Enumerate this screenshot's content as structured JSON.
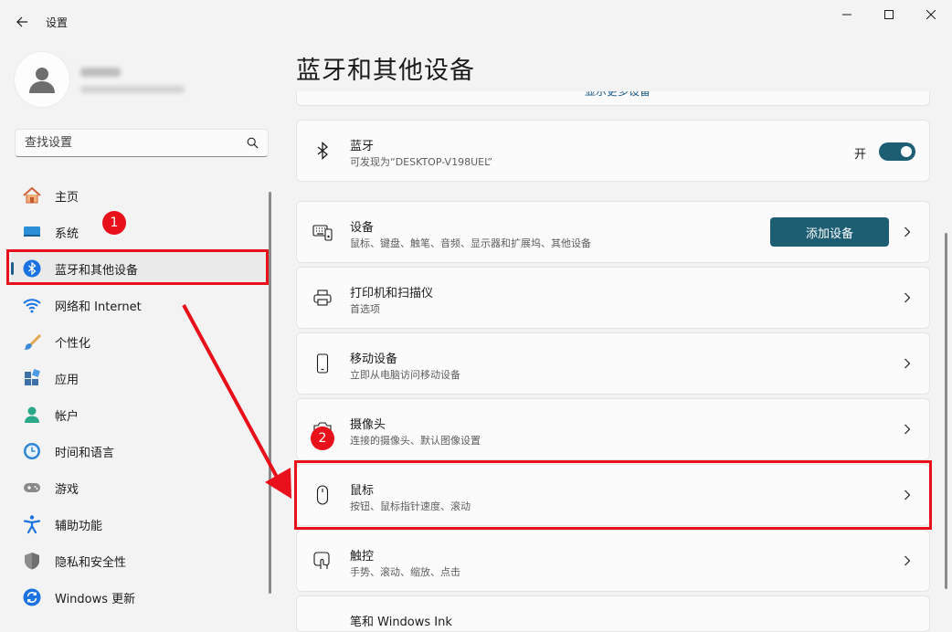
{
  "window": {
    "title": "设置",
    "controls": [
      "minimize",
      "maximize",
      "close"
    ]
  },
  "search": {
    "placeholder": "查找设置"
  },
  "sidebar": {
    "items": [
      {
        "label": "主页",
        "icon": "home-icon"
      },
      {
        "label": "系统",
        "icon": "system-icon"
      },
      {
        "label": "蓝牙和其他设备",
        "icon": "bluetooth-icon",
        "selected": true
      },
      {
        "label": "网络和 Internet",
        "icon": "wifi-icon"
      },
      {
        "label": "个性化",
        "icon": "brush-icon"
      },
      {
        "label": "应用",
        "icon": "apps-icon"
      },
      {
        "label": "帐户",
        "icon": "account-icon"
      },
      {
        "label": "时间和语言",
        "icon": "time-language-icon"
      },
      {
        "label": "游戏",
        "icon": "gamepad-icon"
      },
      {
        "label": "辅助功能",
        "icon": "accessibility-icon"
      },
      {
        "label": "隐私和安全性",
        "icon": "shield-icon"
      },
      {
        "label": "Windows 更新",
        "icon": "update-icon"
      }
    ]
  },
  "main": {
    "title": "蓝牙和其他设备",
    "partial_link": "显示更多设备",
    "bluetooth": {
      "title": "蓝牙",
      "subtitle": "可发现为“DESKTOP-V198UEL”",
      "toggle_label": "开",
      "enabled": true
    },
    "devices": {
      "title": "设备",
      "subtitle": "鼠标、键盘、触笔、音频、显示器和扩展坞、其他设备",
      "button_label": "添加设备"
    },
    "printers": {
      "title": "打印机和扫描仪",
      "subtitle": "首选项"
    },
    "mobile": {
      "title": "移动设备",
      "subtitle": "立即从电脑访问移动设备"
    },
    "camera": {
      "title": "摄像头",
      "subtitle": "连接的摄像头、默认图像设置"
    },
    "mouse": {
      "title": "鼠标",
      "subtitle": "按钮、鼠标指针速度、滚动"
    },
    "touchpad": {
      "title": "触控",
      "subtitle": "手势、滚动、缩放、点击"
    },
    "pen": {
      "title": "笔和 Windows Ink"
    }
  },
  "annotations": {
    "step1": "1",
    "step2": "2",
    "color": "#e8101a"
  },
  "colors": {
    "accent": "#1d5e73",
    "selected_indicator": "#1f5d8a"
  }
}
